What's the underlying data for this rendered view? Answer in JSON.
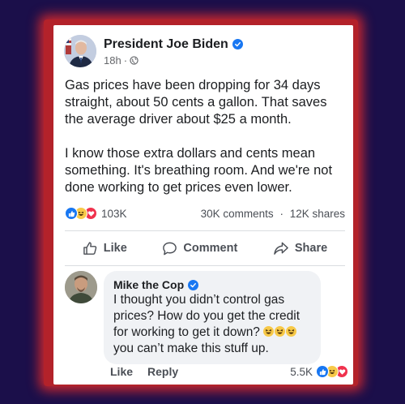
{
  "post": {
    "author": "President Joe Biden",
    "time": "18h",
    "paragraphs": [
      "Gas prices have been dropping for 34 days straight, about 50 cents a gallon. That saves the average driver about $25 a month.",
      "I know those extra dollars and cents mean something. It's breathing room. And we're not done working to get prices even lower."
    ],
    "reaction_count": "103K",
    "comments_count": "30K comments",
    "shares_count": "12K shares",
    "separator": "·"
  },
  "actions": {
    "like": "Like",
    "comment": "Comment",
    "share": "Share"
  },
  "comment": {
    "author": "Mike the Cop",
    "text_before_emoji": "I thought you didn’t control gas prices? How do you get the credit for working to get it down?",
    "text_after_emoji": "you can’t make this stuff up.",
    "like_label": "Like",
    "reply_label": "Reply",
    "reaction_count": "5.5K"
  },
  "colors": {
    "background": "#1b0f4a",
    "frame_glow": "#c4272f",
    "verified": "#1877f2",
    "like_reaction": "#1877f2",
    "haha_reaction": "#f7c948",
    "love_reaction": "#f0324d"
  },
  "icons": {
    "verified": "verified-badge-icon",
    "globe": "globe-icon",
    "like": "thumbs-up-icon",
    "comment": "speech-bubble-icon",
    "share": "share-arrow-icon",
    "haha": "laughing-emoji-icon",
    "love": "heart-icon"
  }
}
